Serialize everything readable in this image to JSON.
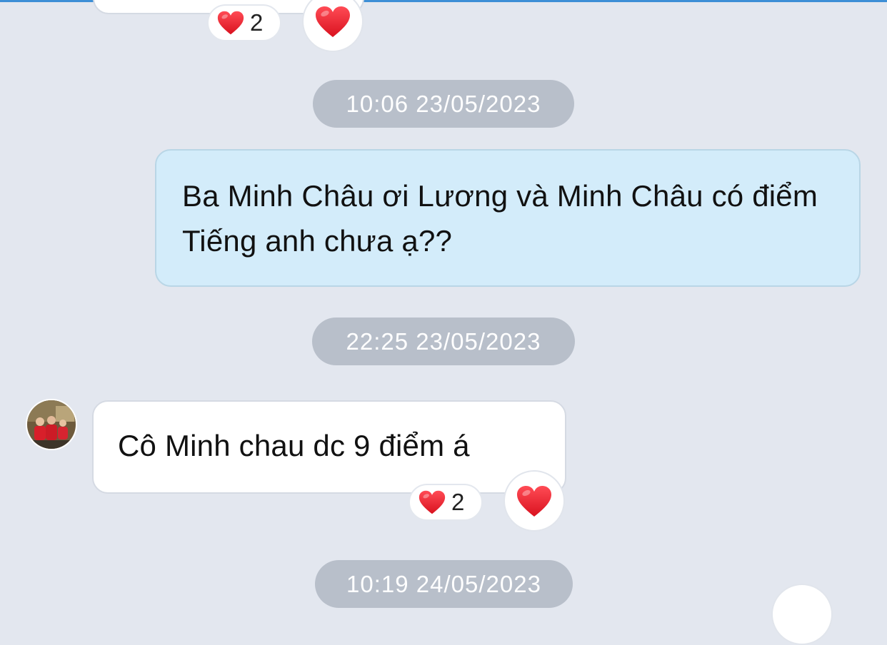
{
  "theme": {
    "background": "#e3e7ef",
    "incoming_bubble": "#ffffff",
    "outgoing_bubble": "#d3ecfa",
    "timestamp_pill": "#b8bfca",
    "heart": "#e8232f"
  },
  "messages": [
    {
      "direction": "incoming",
      "text": "",
      "reaction": {
        "icon": "heart-icon",
        "count": "2"
      }
    },
    {
      "direction": "outgoing",
      "timestamp": "10:06 23/05/2023",
      "text": "Ba Minh Châu ơi Lương và Minh Châu có điểm Tiếng anh chưa ạ??"
    },
    {
      "direction": "incoming",
      "timestamp": "22:25 23/05/2023",
      "sender_avatar": "avatar",
      "text": "Cô Minh chau dc 9 điểm á",
      "reaction": {
        "icon": "heart-icon",
        "count": "2"
      }
    },
    {
      "direction": "incoming",
      "timestamp": "10:19 24/05/2023"
    }
  ]
}
